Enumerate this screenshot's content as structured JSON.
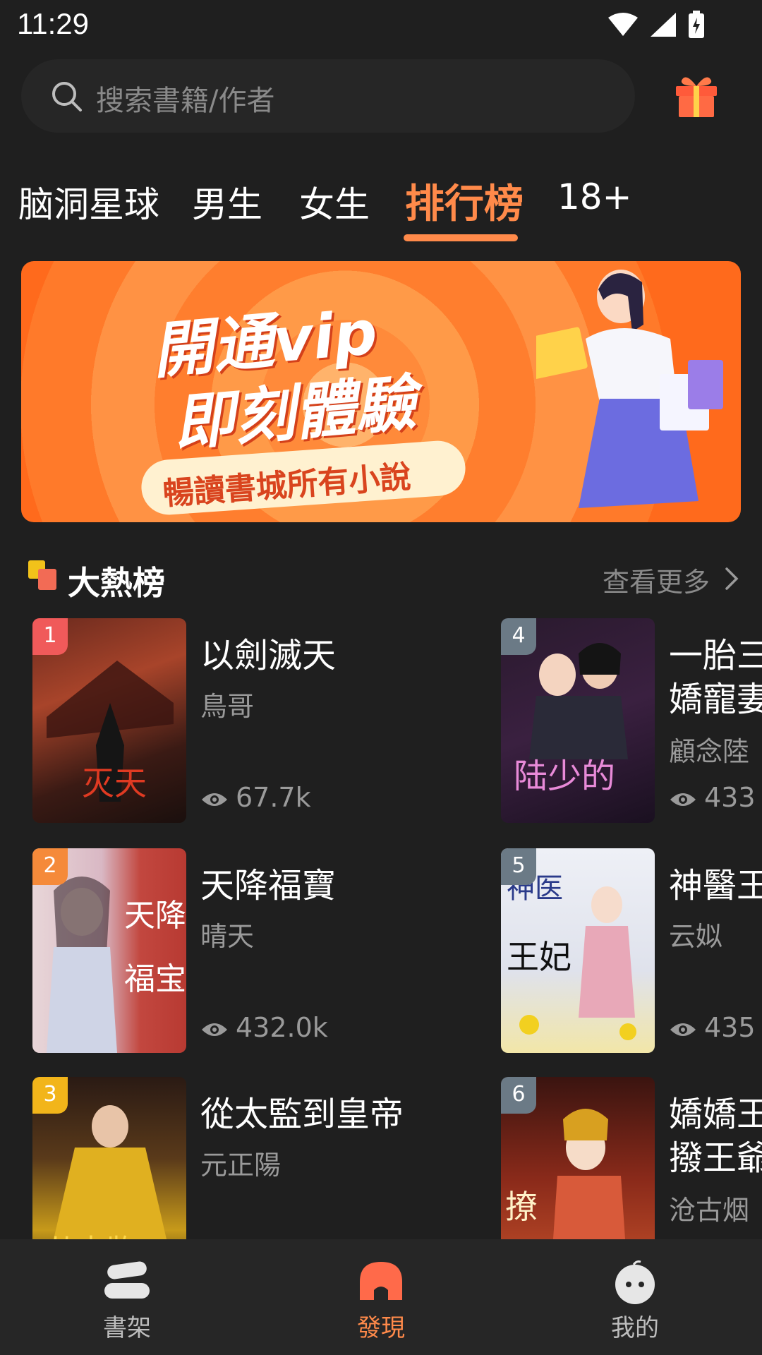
{
  "status_bar": {
    "time": "11:29"
  },
  "search": {
    "placeholder": "搜索書籍/作者"
  },
  "tabs": [
    {
      "label": "脑洞星球",
      "active": false
    },
    {
      "label": "男生",
      "active": false
    },
    {
      "label": "女生",
      "active": false
    },
    {
      "label": "排行榜",
      "active": true
    },
    {
      "label": "18+",
      "active": false
    }
  ],
  "banner": {
    "line1": "開通vip",
    "line2": "即刻體驗",
    "subtitle": "暢讀書城所有小說"
  },
  "section": {
    "title": "大熱榜",
    "more_label": "查看更多"
  },
  "books": [
    {
      "rank": "1",
      "title": "以劍滅天",
      "author": "鳥哥",
      "views": "67.7k",
      "rank_color": "#f05a5a"
    },
    {
      "rank": "2",
      "title": "天降福寶",
      "author": "晴天",
      "views": "432.0k",
      "rank_color": "#f58a3a"
    },
    {
      "rank": "3",
      "title": "從太監到皇帝",
      "author": "元正陽",
      "views": "",
      "rank_color": "#f2b51a"
    },
    {
      "rank": "4",
      "title": "一胎三\n嬌寵妻",
      "author": "顧念陸",
      "views": "433",
      "rank_color": "#6b7a86"
    },
    {
      "rank": "5",
      "title": "神醫王",
      "author": "云姒",
      "views": "435",
      "rank_color": "#6b7a86"
    },
    {
      "rank": "6",
      "title": "嬌嬌王\n撥王爺",
      "author": "沧古烟",
      "views": "",
      "rank_color": "#6b7a86"
    }
  ],
  "bottom_nav": [
    {
      "label": "書架",
      "icon": "bookshelf-icon",
      "active": false
    },
    {
      "label": "發現",
      "icon": "discover-icon",
      "active": true
    },
    {
      "label": "我的",
      "icon": "profile-icon",
      "active": false
    }
  ],
  "colors": {
    "accent": "#ff8a4a",
    "background": "#1f1f1f"
  }
}
